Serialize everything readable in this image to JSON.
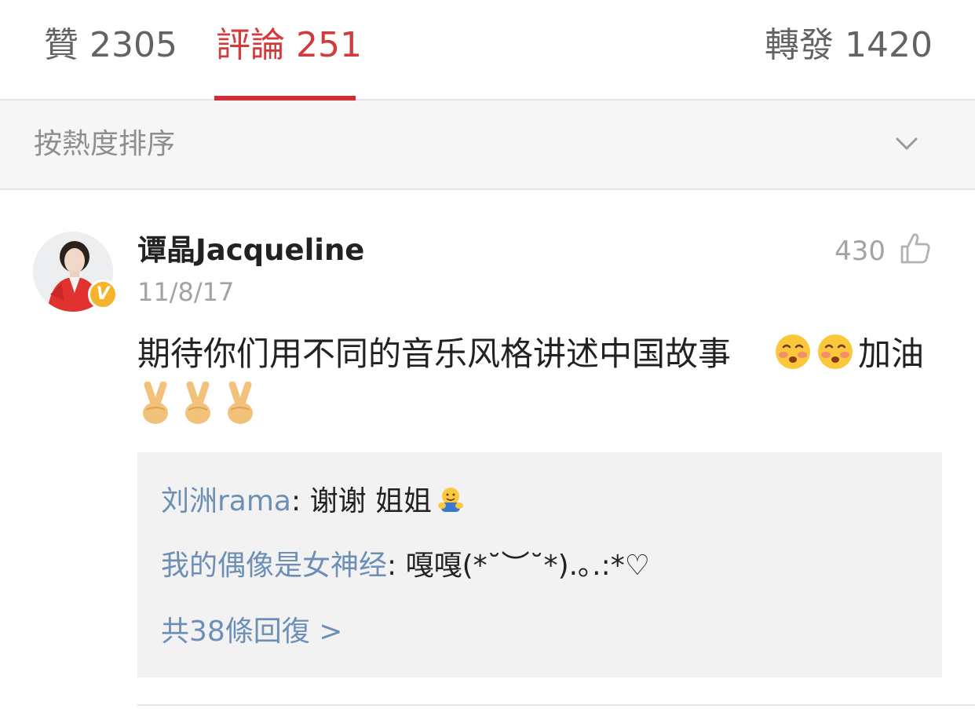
{
  "tabs": {
    "likes": "贊 2305",
    "comments": "評論 251",
    "reposts": "轉發 1420"
  },
  "sort": {
    "label": "按熱度排序",
    "icon": "chevron-down-icon"
  },
  "comment": {
    "username": "谭晶Jacqueline",
    "timestamp": "11/8/17",
    "like_count": "430",
    "text": "期待你们用不同的音乐风格讲述中国故事",
    "text_tail": "加油",
    "emojis_inline": [
      "blushing-face-emoji",
      "blushing-face-emoji"
    ],
    "emojis_row": [
      "victory-hand-emoji",
      "victory-hand-emoji",
      "victory-hand-emoji"
    ],
    "verified_badge": "V",
    "colors": {
      "accent_red": "#d12d34",
      "reply_link_blue": "#6d8fb6",
      "verified_gold": "#f5b42a"
    }
  },
  "replies": {
    "items": [
      {
        "author": "刘洲rama",
        "separator": ": ",
        "text": "谢谢 姐姐",
        "emoji": "hugging-emoji"
      },
      {
        "author": "我的偶像是女神经",
        "separator": ": ",
        "text": "嘎嘎(*˘︶˘*).｡.:*♡"
      }
    ],
    "more_label": "共38條回復 >"
  }
}
